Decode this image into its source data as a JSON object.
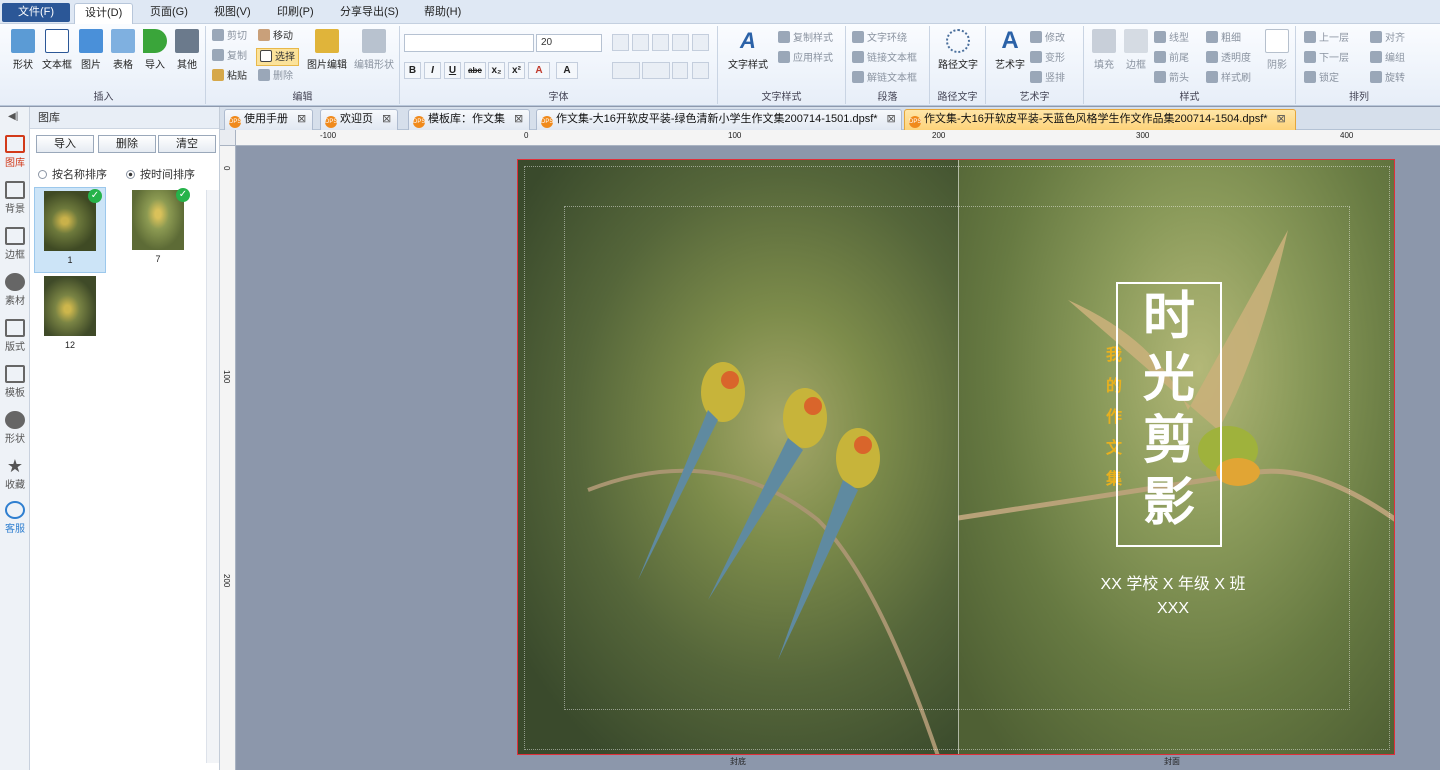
{
  "menu": [
    "文件(F)",
    "设计(D)",
    "页面(G)",
    "视图(V)",
    "印刷(P)",
    "分享导出(S)",
    "帮助(H)"
  ],
  "ribbon": {
    "insert": {
      "label": "插入",
      "buttons": [
        "形状",
        "文本框",
        "图片",
        "表格",
        "导入",
        "其他"
      ]
    },
    "edit": {
      "label": "编辑",
      "cut": "剪切",
      "copy": "复制",
      "paste": "粘贴",
      "move": "移动",
      "select": "选择",
      "delete": "删除",
      "pic_edit": "图片编辑",
      "shape_edit": "编辑形状"
    },
    "font": {
      "label": "字体",
      "font_name": "",
      "font_size": "20",
      "bold": "B",
      "italic": "I",
      "underline": "U",
      "strike": "abc",
      "sub": "x₂",
      "sup": "x²",
      "color": "A",
      "color2": "A"
    },
    "textstyle": {
      "label": "文字样式",
      "btn": "文字样式",
      "copy": "复制样式",
      "apply": "应用样式"
    },
    "para": {
      "label": "段落",
      "wrap": "文字环绕",
      "link": "链接文本框",
      "unlink": "解链文本框"
    },
    "path": {
      "label": "路径文字",
      "btn": "路径文字"
    },
    "art": {
      "label": "艺术字",
      "btn": "艺术字",
      "modify": "修改",
      "deform": "变形",
      "vertical": "竖排"
    },
    "style": {
      "label": "样式",
      "fill": "填充",
      "border": "边框",
      "line": "线型",
      "thick": "粗细",
      "front": "前尾",
      "opacity": "透明度",
      "arrow": "箭头",
      "brush": "样式刷",
      "shadow": "阴影"
    },
    "arrange": {
      "label": "排列",
      "up": "上一层",
      "down": "下一层",
      "lock": "锁定",
      "align": "对齐",
      "group": "编组",
      "rotate": "旋转"
    }
  },
  "leftnav": [
    "图库",
    "背景",
    "边框",
    "素材",
    "版式",
    "模板",
    "形状",
    "收藏",
    "客服"
  ],
  "panel": {
    "title": "图库",
    "import": "导入",
    "delete": "删除",
    "clear": "清空",
    "sort_name": "按名称排序",
    "sort_time": "按时间排序",
    "thumbs": [
      {
        "label": "1",
        "used": true
      },
      {
        "label": "7",
        "used": true
      },
      {
        "label": "12",
        "used": false
      }
    ]
  },
  "tabs": [
    {
      "label": "使用手册",
      "active": false
    },
    {
      "label": "欢迎页",
      "active": false
    },
    {
      "label": "模板库：作文集",
      "active": false
    },
    {
      "label": "作文集-大16开软皮平装-绿色清新小学生作文集200714-1501.dpsf*",
      "active": false
    },
    {
      "label": "作文集-大16开软皮平装-天蓝色风格学生作文作品集200714-1504.dpsf*",
      "active": true
    }
  ],
  "ruler": {
    "h": [
      "-100",
      "0",
      "100",
      "200",
      "300",
      "400"
    ],
    "v": [
      "0",
      "100",
      "200"
    ]
  },
  "cover": {
    "title_chars": [
      "时",
      "光",
      "剪",
      "影"
    ],
    "subtitle_chars": [
      "我",
      "的",
      "作",
      "文",
      "集"
    ],
    "school": "XX 学校 X 年级 X 班",
    "name": "XXX",
    "page_label_left": "封底",
    "page_label_right": "封面"
  }
}
